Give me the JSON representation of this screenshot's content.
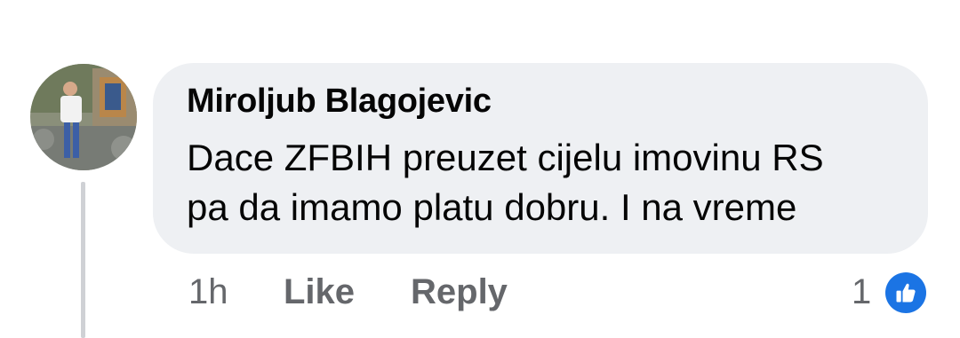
{
  "comment": {
    "author": "Miroljub Blagojevic",
    "text_lines": [
      "Dace ZFBIH preuzet cijelu imovinu RS",
      "pa da imamo platu dobru. I na vreme"
    ]
  },
  "actions": {
    "time": "1h",
    "like_label": "Like",
    "reply_label": "Reply"
  },
  "reactions": {
    "count": "1",
    "icon": "thumbs-up-icon",
    "color": "#1b74e4"
  },
  "colors": {
    "bubble": "#eef0f3",
    "text": "#050505",
    "meta": "#65676b"
  }
}
